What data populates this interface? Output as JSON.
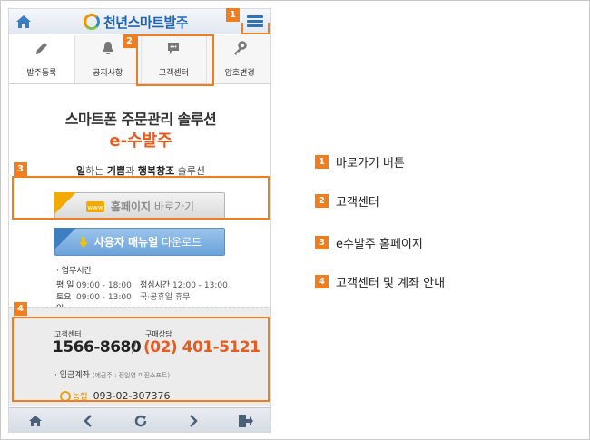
{
  "app": {
    "logo_text": "천년스마트발주"
  },
  "tabs": [
    {
      "label": "발주등록",
      "icon": "pencil-icon"
    },
    {
      "label": "공지사항",
      "icon": "bell-icon"
    },
    {
      "label": "고객센터",
      "icon": "chat-icon"
    },
    {
      "label": "암호변경",
      "icon": "key-icon"
    }
  ],
  "hero": {
    "title_line1": "스마트폰 주문관리 솔루션",
    "title_line2": "e-수발주",
    "sub_part1": "일",
    "sub_part2": "하는 ",
    "sub_part3": "기쁨",
    "sub_part4": "과 ",
    "sub_part5": "행복창조",
    "sub_part6": " 솔루션",
    "website_ribbon": "WEBSITE",
    "website_button_bold": "홈페이지",
    "website_button_rest": " 바로가기",
    "download_ribbon": "DOWNLOAD",
    "download_button_bold": "사용자 매뉴얼",
    "download_button_rest": " 다운로드"
  },
  "hours": {
    "title": "· 업무시간",
    "rows": [
      {
        "day": "평  일",
        "time": "09:00 - 18:00",
        "label": "점심시간",
        "value": "12:00 - 13:00"
      },
      {
        "day": "토요일",
        "time": "09:00 - 13:00",
        "label": "국·공휴일 휴무",
        "value": ""
      }
    ]
  },
  "contact": {
    "support_label": "고객센터",
    "support_phone": "1566-8680",
    "separator": "/",
    "sales_label": "구매상담",
    "sales_phone": "(02) 401-5121",
    "bank_title": "· 입금계좌",
    "bank_holder": "(예금주 : 정일영 미진소프트)",
    "bank_name": "농협",
    "bank_account": "093-02-307376"
  },
  "callouts": [
    "1",
    "2",
    "3",
    "4"
  ],
  "legend": [
    {
      "num": "1",
      "label": "바로가기 버튼"
    },
    {
      "num": "2",
      "label": "고객센터"
    },
    {
      "num": "3",
      "label": "e수발주 홈페이지"
    },
    {
      "num": "4",
      "label": "고객센터 및 계좌 안내"
    }
  ],
  "colors": {
    "accent": "#f07d1e",
    "brand_blue": "#1e64b4",
    "highlight_orange": "#e85b1e"
  }
}
